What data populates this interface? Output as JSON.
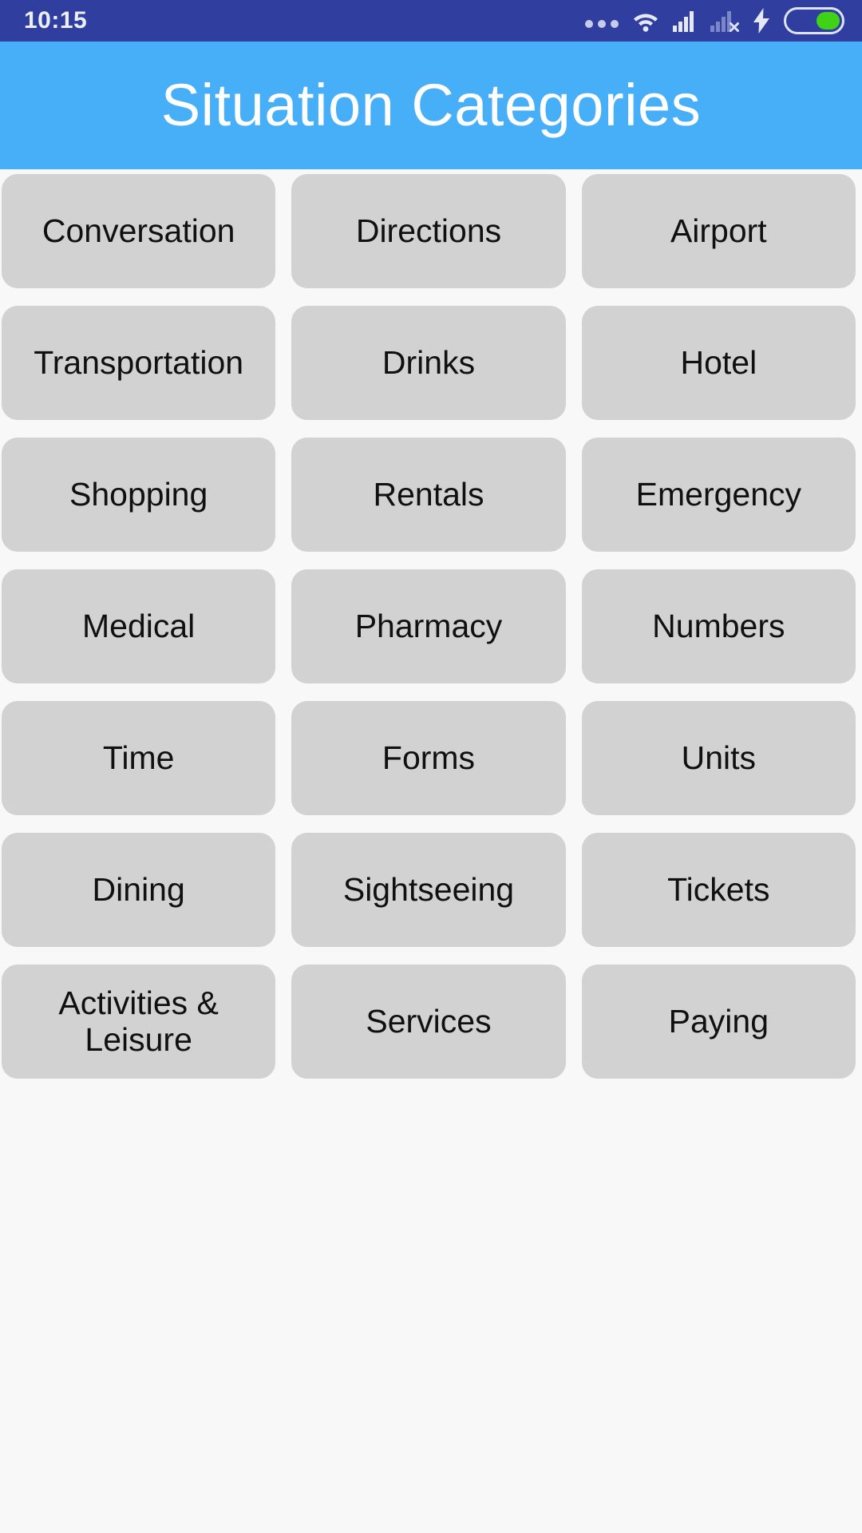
{
  "status_bar": {
    "time": "10:15",
    "background_color": "#303F9F",
    "icons": [
      {
        "name": "more-dots-icon",
        "label": "notifications"
      },
      {
        "name": "wifi-icon",
        "label": "wifi connected"
      },
      {
        "name": "cellular-signal-icon",
        "label": "signal full"
      },
      {
        "name": "cellular-signal-no-sim-icon",
        "label": "no sim"
      },
      {
        "name": "charging-bolt-icon",
        "label": "charging"
      },
      {
        "name": "battery-icon",
        "label": "battery"
      }
    ],
    "battery": {
      "level_percent": 42,
      "fill_color": "#3FD216",
      "outline_color": "#DFE3F3"
    }
  },
  "header": {
    "title": "Situation Categories",
    "background_color": "#47AEF8",
    "text_color": "#FFFFFF"
  },
  "theme": {
    "page_background": "#F8F8F9",
    "button_background": "#D2D2D2",
    "button_text_color": "#101010"
  },
  "grid": {
    "columns": 3,
    "items": [
      {
        "label": "Conversation"
      },
      {
        "label": "Directions"
      },
      {
        "label": "Airport"
      },
      {
        "label": "Transportation"
      },
      {
        "label": "Drinks"
      },
      {
        "label": "Hotel"
      },
      {
        "label": "Shopping"
      },
      {
        "label": "Rentals"
      },
      {
        "label": "Emergency"
      },
      {
        "label": "Medical"
      },
      {
        "label": "Pharmacy"
      },
      {
        "label": "Numbers"
      },
      {
        "label": "Time"
      },
      {
        "label": "Forms"
      },
      {
        "label": "Units"
      },
      {
        "label": "Dining"
      },
      {
        "label": "Sightseeing"
      },
      {
        "label": "Tickets"
      },
      {
        "label": "Activities &\nLeisure"
      },
      {
        "label": "Services"
      },
      {
        "label": "Paying"
      }
    ]
  }
}
